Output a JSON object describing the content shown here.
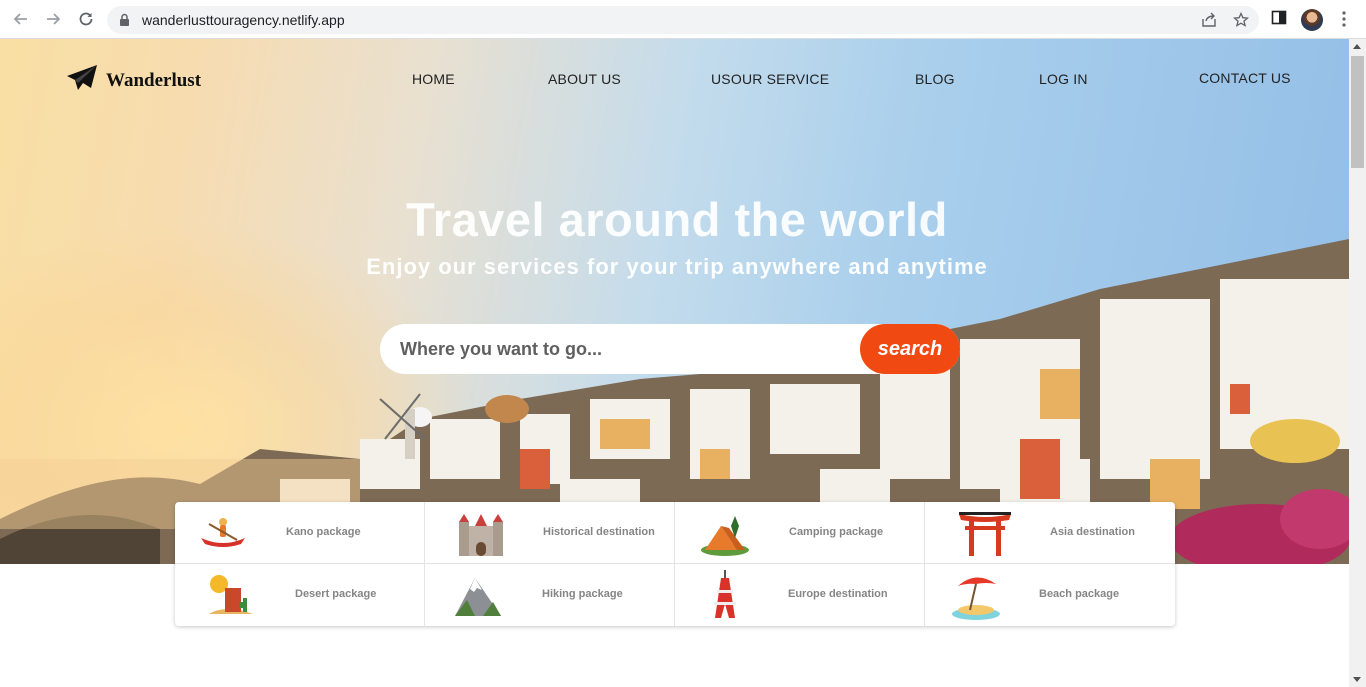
{
  "browser": {
    "url": "wanderlusttouragency.netlify.app",
    "icons": [
      "back-icon",
      "forward-icon",
      "reload-icon",
      "lock-icon",
      "share-icon",
      "star-icon",
      "side-panel-icon",
      "menu-icon"
    ]
  },
  "brand": {
    "name": "Wanderlust",
    "icon": "paper-plane-icon"
  },
  "nav": {
    "items": [
      "HOME",
      "ABOUT US",
      "USOUR SERVICE",
      "BLOG",
      "LOG IN",
      "CONTACT US"
    ]
  },
  "hero": {
    "title": "Travel around the world",
    "subtitle": "Enjoy our services for your trip anywhere and anytime"
  },
  "search": {
    "placeholder": "Where you want to go...",
    "button_label": "search",
    "button_color": "#f04a12"
  },
  "packages": [
    {
      "label": "Kano package",
      "icon": "canoe-icon"
    },
    {
      "label": "Historical destination",
      "icon": "castle-icon"
    },
    {
      "label": "Camping package",
      "icon": "tent-icon"
    },
    {
      "label": "Asia destination",
      "icon": "torii-gate-icon"
    },
    {
      "label": "Desert package",
      "icon": "desert-icon"
    },
    {
      "label": "Hiking package",
      "icon": "mountain-icon"
    },
    {
      "label": "Europe destination",
      "icon": "tower-icon"
    },
    {
      "label": "Beach package",
      "icon": "beach-umbrella-icon"
    }
  ]
}
